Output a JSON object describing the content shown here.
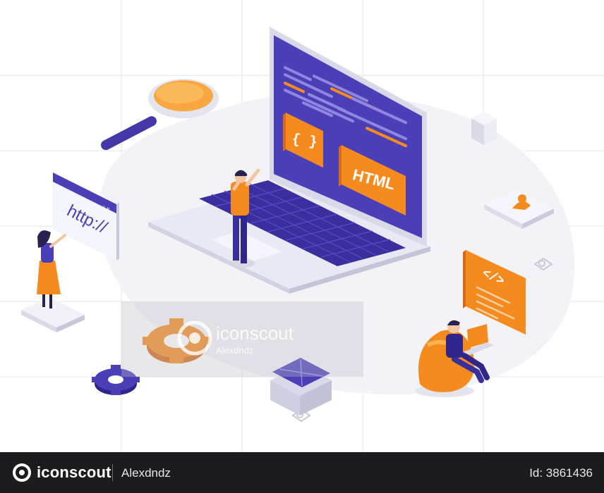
{
  "illustration": {
    "screen_tag_braces": "{ }",
    "screen_tag_html": "HTML",
    "browser_url": "http://",
    "browser_controls": "_ ▫ x",
    "code_card_tag": "</>"
  },
  "watermark": {
    "brand": "iconscout",
    "author": "Alexdndz"
  },
  "footer": {
    "brand": "iconscout",
    "author": "Alexdndz",
    "asset_id": "Id: 3861436"
  },
  "colors": {
    "primary": "#4b3fb8",
    "accent": "#f58a1f",
    "footer_bg": "#1c1c1f"
  }
}
